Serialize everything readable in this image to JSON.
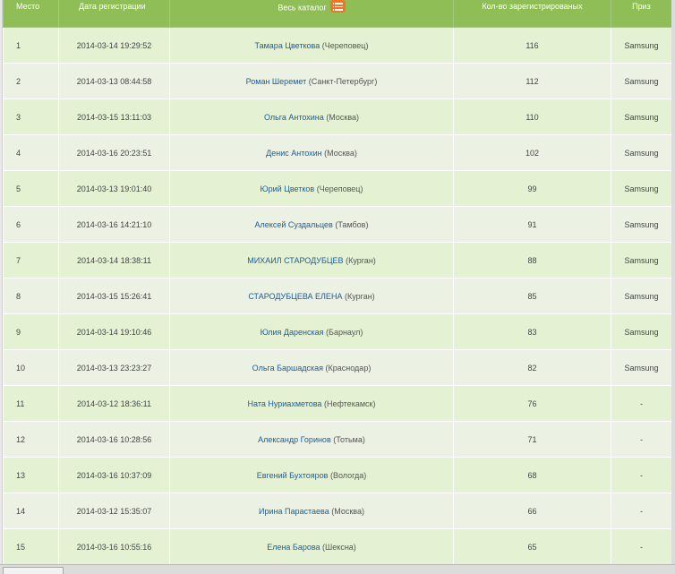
{
  "table": {
    "headers": {
      "place": "Место",
      "date": "Дата регистрации",
      "catalog": "Весь каталог",
      "count": "Кол-во зарегистрированых",
      "prize": "Приз"
    },
    "rows": [
      {
        "place": "1",
        "date": "2014-03-14 19:29:52",
        "name": "Тамара Цветкова",
        "city": "(Череповец)",
        "count": "116",
        "prize": "Samsung"
      },
      {
        "place": "2",
        "date": "2014-03-13 08:44:58",
        "name": "Роман Шеремет",
        "city": "(Санкт-Петербург)",
        "count": "112",
        "prize": "Samsung"
      },
      {
        "place": "3",
        "date": "2014-03-15 13:11:03",
        "name": "Ольга Антохина",
        "city": "(Москва)",
        "count": "110",
        "prize": "Samsung"
      },
      {
        "place": "4",
        "date": "2014-03-16 20:23:51",
        "name": "Денис Антохин",
        "city": "(Москва)",
        "count": "102",
        "prize": "Samsung"
      },
      {
        "place": "5",
        "date": "2014-03-13 19:01:40",
        "name": "Юрий Цветков",
        "city": "(Череповец)",
        "count": "99",
        "prize": "Samsung"
      },
      {
        "place": "6",
        "date": "2014-03-16 14:21:10",
        "name": "Алексей Суздальцев",
        "city": "(Тамбов)",
        "count": "91",
        "prize": "Samsung"
      },
      {
        "place": "7",
        "date": "2014-03-14 18:38:11",
        "name": "МИХАИЛ СТАРОДУБЦЕВ",
        "city": "(Курган)",
        "count": "88",
        "prize": "Samsung"
      },
      {
        "place": "8",
        "date": "2014-03-15 15:26:41",
        "name": "СТАРОДУБЦЕВА ЕЛЕНА",
        "city": "(Курган)",
        "count": "85",
        "prize": "Samsung"
      },
      {
        "place": "9",
        "date": "2014-03-14 19:10:46",
        "name": "Юлия Даренская",
        "city": "(Барнаул)",
        "count": "83",
        "prize": "Samsung"
      },
      {
        "place": "10",
        "date": "2014-03-13 23:23:27",
        "name": "Ольга Баршадская",
        "city": "(Краснодар)",
        "count": "82",
        "prize": "Samsung"
      },
      {
        "place": "11",
        "date": "2014-03-12 18:36:11",
        "name": "Ната Нуриахметова",
        "city": "(Нефтекамск)",
        "count": "76",
        "prize": "-"
      },
      {
        "place": "12",
        "date": "2014-03-16 10:28:56",
        "name": "Александр Горинов",
        "city": "(Тотьма)",
        "count": "71",
        "prize": "-"
      },
      {
        "place": "13",
        "date": "2014-03-16 10:37:09",
        "name": "Евгений Бухтояров",
        "city": "(Вологда)",
        "count": "68",
        "prize": "-"
      },
      {
        "place": "14",
        "date": "2014-03-12 15:35:07",
        "name": "Ирина Парастаева",
        "city": "(Москва)",
        "count": "66",
        "prize": "-"
      },
      {
        "place": "15",
        "date": "2014-03-16 10:55:16",
        "name": "Елена Барова",
        "city": "(Шексна)",
        "count": "65",
        "prize": "-"
      }
    ]
  },
  "icons": {
    "catalog": "list-icon"
  },
  "colors": {
    "header_bg": "#8fbe56",
    "row_odd": "#e4f2d3",
    "row_even": "#ebf1e3",
    "link": "#1d5c99",
    "icon": "#f07528"
  }
}
